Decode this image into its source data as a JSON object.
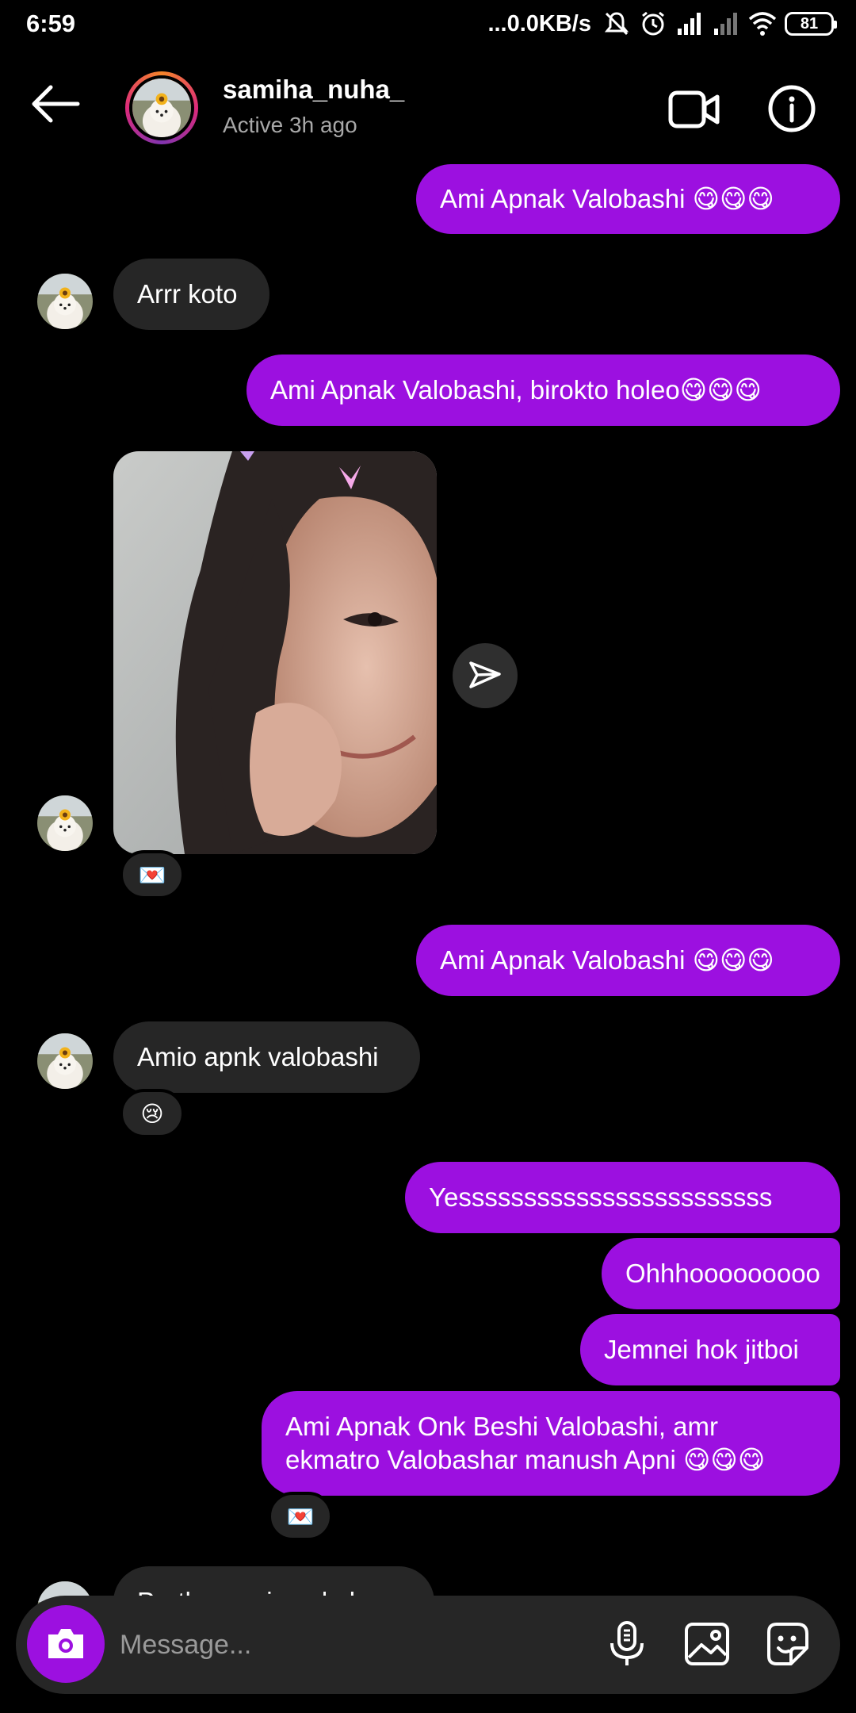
{
  "status_bar": {
    "time": "6:59",
    "speed": "...0.0KB/s",
    "battery": "81"
  },
  "header": {
    "username": "samiha_nuha_",
    "status": "Active 3h ago"
  },
  "messages": {
    "m1": "Ami Apnak Valobashi 😋😋😋",
    "m2": "Arrr koto",
    "m3": "Ami Apnak Valobashi, birokto holeo😋😋😋",
    "m4_reaction": "💌",
    "m5": "Ami Apnak Valobashi 😋😋😋",
    "m6": "Amio apnk valobashi",
    "m6_reaction": "😢",
    "m7": "Yessssssssssssssssssssssss",
    "m8": "Ohhhooooooooo",
    "m9": "Jemnei hok jitboi",
    "m10_line1": "Ami Apnak Onk Beshi Valobashi, amr",
    "m10_line2": "ekmatro Valobashar manush Apni 😋😋😋",
    "m10_reaction": "💌",
    "m11_partial": "Porthom roja sokol"
  },
  "composer": {
    "placeholder": "Message..."
  },
  "colors": {
    "sent_bubble": "#9c10e0",
    "received_bubble": "#262626",
    "background": "#000000"
  },
  "icons": [
    "back-arrow-icon",
    "video-call-icon",
    "info-icon",
    "send-icon",
    "camera-icon",
    "microphone-icon",
    "gallery-icon",
    "sticker-icon"
  ]
}
